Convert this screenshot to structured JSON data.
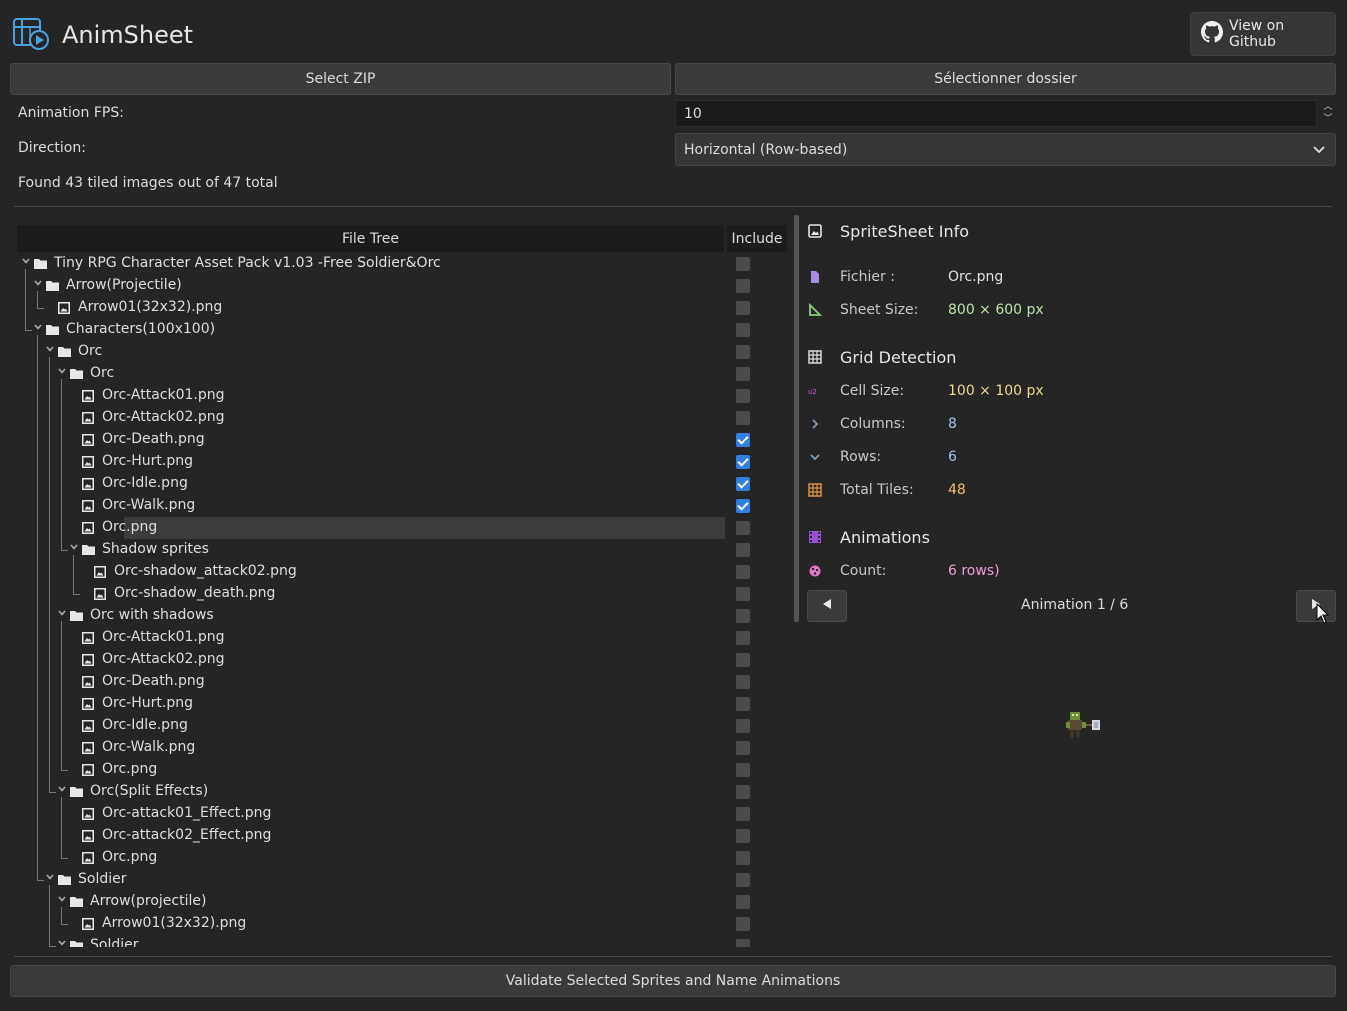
{
  "app": {
    "title": "AnimSheet",
    "github_label": "View on Github"
  },
  "buttons": {
    "select_zip": "Select ZIP",
    "select_folder": "Sélectionner dossier",
    "validate": "Validate Selected Sprites and Name Animations"
  },
  "settings": {
    "fps_label": "Animation FPS:",
    "fps_value": "10",
    "direction_label": "Direction:",
    "direction_value": "Horizontal (Row-based)"
  },
  "status": {
    "found_text": "Found 43 tiled images out of 47 total"
  },
  "tree": {
    "header_file": "File Tree",
    "header_include": "Include",
    "rows": [
      {
        "label": "Tiny RPG Character Asset Pack v1.03 -Free Soldier&Orc",
        "type": "folder",
        "depth": 0,
        "expanded": true,
        "checked": false
      },
      {
        "label": "Arrow(Projectile)",
        "type": "folder",
        "depth": 1,
        "expanded": true,
        "checked": false
      },
      {
        "label": "Arrow01(32x32).png",
        "type": "file",
        "depth": 2,
        "checked": false
      },
      {
        "label": "Characters(100x100)",
        "type": "folder",
        "depth": 1,
        "expanded": true,
        "checked": false
      },
      {
        "label": "Orc",
        "type": "folder",
        "depth": 2,
        "expanded": true,
        "checked": false
      },
      {
        "label": "Orc",
        "type": "folder",
        "depth": 3,
        "expanded": true,
        "checked": false
      },
      {
        "label": "Orc-Attack01.png",
        "type": "file",
        "depth": 4,
        "checked": false
      },
      {
        "label": "Orc-Attack02.png",
        "type": "file",
        "depth": 4,
        "checked": false
      },
      {
        "label": "Orc-Death.png",
        "type": "file",
        "depth": 4,
        "checked": true
      },
      {
        "label": "Orc-Hurt.png",
        "type": "file",
        "depth": 4,
        "checked": true
      },
      {
        "label": "Orc-Idle.png",
        "type": "file",
        "depth": 4,
        "checked": true
      },
      {
        "label": "Orc-Walk.png",
        "type": "file",
        "depth": 4,
        "checked": true
      },
      {
        "label": "Orc.png",
        "type": "file",
        "depth": 4,
        "checked": false,
        "selected": true
      },
      {
        "label": "Shadow sprites",
        "type": "folder",
        "depth": 4,
        "expanded": true,
        "checked": false
      },
      {
        "label": "Orc-shadow_attack02.png",
        "type": "file",
        "depth": 5,
        "checked": false
      },
      {
        "label": "Orc-shadow_death.png",
        "type": "file",
        "depth": 5,
        "checked": false
      },
      {
        "label": "Orc with shadows",
        "type": "folder",
        "depth": 3,
        "expanded": true,
        "checked": false
      },
      {
        "label": "Orc-Attack01.png",
        "type": "file",
        "depth": 4,
        "checked": false
      },
      {
        "label": "Orc-Attack02.png",
        "type": "file",
        "depth": 4,
        "checked": false
      },
      {
        "label": "Orc-Death.png",
        "type": "file",
        "depth": 4,
        "checked": false
      },
      {
        "label": "Orc-Hurt.png",
        "type": "file",
        "depth": 4,
        "checked": false
      },
      {
        "label": "Orc-Idle.png",
        "type": "file",
        "depth": 4,
        "checked": false
      },
      {
        "label": "Orc-Walk.png",
        "type": "file",
        "depth": 4,
        "checked": false
      },
      {
        "label": "Orc.png",
        "type": "file",
        "depth": 4,
        "checked": false
      },
      {
        "label": "Orc(Split Effects)",
        "type": "folder",
        "depth": 3,
        "expanded": true,
        "checked": false
      },
      {
        "label": "Orc-attack01_Effect.png",
        "type": "file",
        "depth": 4,
        "checked": false
      },
      {
        "label": "Orc-attack02_Effect.png",
        "type": "file",
        "depth": 4,
        "checked": false
      },
      {
        "label": "Orc.png",
        "type": "file",
        "depth": 4,
        "checked": false
      },
      {
        "label": "Soldier",
        "type": "folder",
        "depth": 2,
        "expanded": true,
        "checked": false
      },
      {
        "label": "Arrow(projectile)",
        "type": "folder",
        "depth": 3,
        "expanded": true,
        "checked": false
      },
      {
        "label": "Arrow01(32x32).png",
        "type": "file",
        "depth": 4,
        "checked": false
      },
      {
        "label": "Soldier",
        "type": "folder",
        "depth": 3,
        "expanded": true,
        "checked": false
      }
    ]
  },
  "info": {
    "spritesheet_title": "SpriteSheet Info",
    "file_key": "Fichier :",
    "file_value": "Orc.png",
    "size_key": "Sheet Size:",
    "size_value": "800 × 600 px",
    "grid_title": "Grid Detection",
    "cell_key": "Cell Size:",
    "cell_value": "100 × 100 px",
    "cols_key": "Columns:",
    "cols_value": "8",
    "rows_key": "Rows:",
    "rows_value": "6",
    "tiles_key": "Total Tiles:",
    "tiles_value": "48",
    "anim_title": "Animations",
    "count_key": "Count:",
    "count_value": "6 rows)",
    "anim_nav": "Animation 1 / 6",
    "colors": {
      "file": "#e0e0e0",
      "size": "#b9e4a6",
      "cell": "#f1d78a",
      "cols": "#9ec3ee",
      "rows": "#9ec3ee",
      "tiles": "#f3c06a",
      "count": "#f39ad9"
    }
  }
}
